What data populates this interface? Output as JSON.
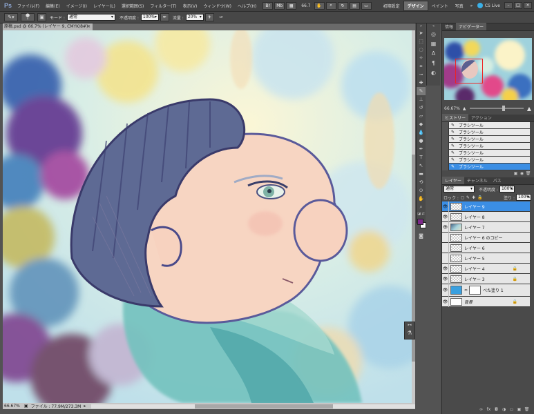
{
  "menubar": {
    "logo": "Ps",
    "items": [
      "ファイル(F)",
      "編集(E)",
      "イメージ(I)",
      "レイヤー(L)",
      "選択範囲(S)",
      "フィルター(T)",
      "表示(V)",
      "ウィンドウ(W)",
      "ヘルプ(H)"
    ],
    "zoom": "66.7",
    "workspaces": [
      "初期設定",
      "デザイン",
      "ペイント",
      "写真"
    ],
    "active_workspace": "デザイン",
    "cslive": "CS Live",
    "more": "»"
  },
  "options": {
    "mode_label": "モード :",
    "mode_value": "通常",
    "opacity_label": "不透明度 :",
    "opacity_value": "100%",
    "flow_label": "流量 :",
    "flow_value": "20%",
    "brush_size": "1"
  },
  "document": {
    "tab_title": "原稿.psd @ 66.7% (レイヤー 9, CMYK/8#)",
    "close": "×",
    "status_zoom": "66.67%",
    "status_file": "ファイル : 77.9M/273.3M"
  },
  "navigator": {
    "tabs": [
      "情報",
      "ナビゲーター"
    ],
    "zoom": "66.67%"
  },
  "history": {
    "tabs": [
      "ヒストリー",
      "アクション"
    ],
    "items": [
      "ブラシツール",
      "ブラシツール",
      "ブラシツール",
      "ブラシツール",
      "ブラシツール",
      "ブラシツール",
      "ブラシツール"
    ]
  },
  "layers": {
    "tabs": [
      "レイヤー",
      "チャンネル",
      "パス"
    ],
    "blend": "通常",
    "opacity_label": "不透明度 :",
    "opacity": "100%",
    "lock_label": "ロック :",
    "fill_label": "塗り :",
    "fill": "100%",
    "items": [
      {
        "name": "レイヤー 9",
        "visible": true,
        "active": true,
        "locked": false,
        "thumb": "transparent"
      },
      {
        "name": "レイヤー 8",
        "visible": true,
        "active": false,
        "locked": false,
        "thumb": "transparent"
      },
      {
        "name": "レイヤー 7",
        "visible": true,
        "active": false,
        "locked": false,
        "thumb": "painting"
      },
      {
        "name": "レイヤー 6 のコピー",
        "visible": false,
        "active": false,
        "locked": false,
        "thumb": "transparent"
      },
      {
        "name": "レイヤー 6",
        "visible": false,
        "active": false,
        "locked": false,
        "thumb": "transparent"
      },
      {
        "name": "レイヤー 5",
        "visible": false,
        "active": false,
        "locked": false,
        "thumb": "transparent"
      },
      {
        "name": "レイヤー 4",
        "visible": true,
        "active": false,
        "locked": true,
        "thumb": "transparent"
      },
      {
        "name": "レイヤー 3",
        "visible": true,
        "active": false,
        "locked": true,
        "thumb": "transparent"
      },
      {
        "name": "べた塗り 1",
        "visible": true,
        "active": false,
        "locked": false,
        "thumb": "fill"
      },
      {
        "name": "背景",
        "visible": true,
        "active": false,
        "locked": true,
        "thumb": "white"
      }
    ]
  },
  "colors": {
    "foreground": "#7d2a8a",
    "background": "#ffffff",
    "selection": "#3b8ee4",
    "fill_layer": "#3aa0e0"
  }
}
